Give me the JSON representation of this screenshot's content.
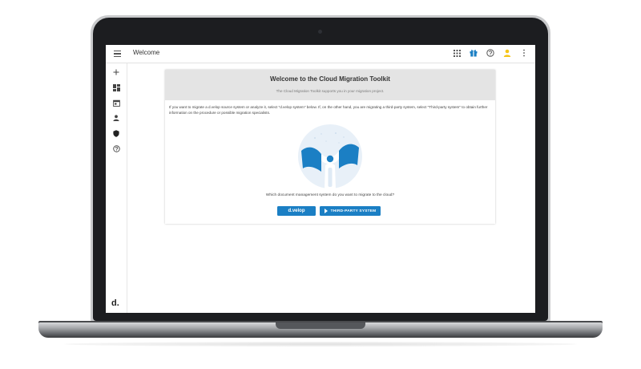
{
  "app": {
    "title": "Welcome",
    "brand": "d."
  },
  "topbar": {
    "icons": [
      "apps-grid-icon",
      "gift-icon",
      "help-circle-icon",
      "user-icon",
      "more-vert-icon"
    ],
    "accent_user": "#f5c518",
    "accent_gift": "#1b7fc4"
  },
  "sidebar": {
    "items": [
      {
        "icon": "plus-icon"
      },
      {
        "icon": "dashboard-icon"
      },
      {
        "icon": "calendar-icon"
      },
      {
        "icon": "person-icon"
      },
      {
        "icon": "shield-icon"
      },
      {
        "icon": "help-circle-icon"
      }
    ]
  },
  "welcome": {
    "title": "Welcome to the Cloud Migration Toolkit",
    "subtitle": "The Cloud Migration Toolkit supports you in your migration project.",
    "intro": "If you want to migrate a d.velop source system or analyze it, select \"d.velop system\" below. If, on the other hand, you are migrating a third-party system, select \"Third-party system\" to obtain further information on the procedure or possible migration specialists.",
    "question": "Which document management system do you want to migrate to the cloud?",
    "button_dvelop": "d.velop",
    "button_third_party": "THIRD-PARTY SYSTEM"
  },
  "colors": {
    "primary": "#1b7fc4",
    "header_bg": "#e4e4e4"
  }
}
